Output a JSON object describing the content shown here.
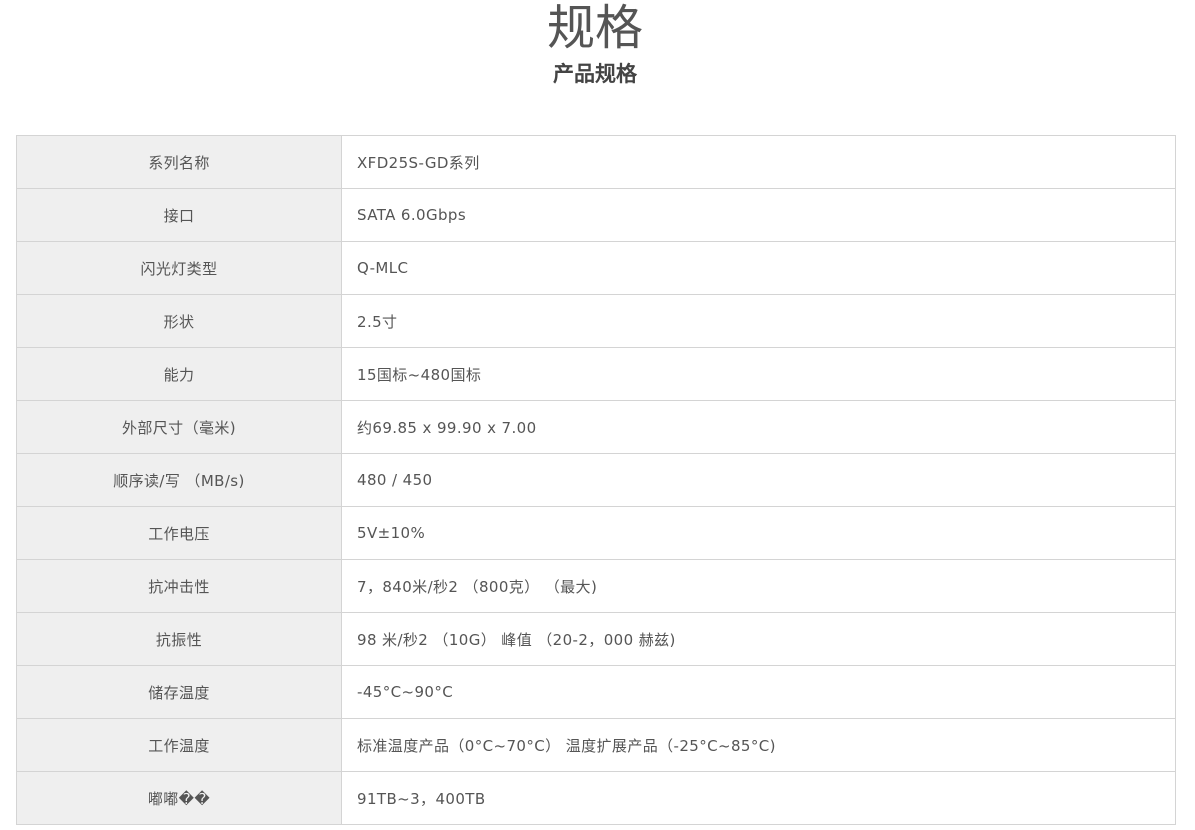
{
  "header": {
    "title": "规格",
    "subtitle": "产品规格"
  },
  "specs": [
    {
      "label": "系列名称",
      "value": "XFD25S-GD系列"
    },
    {
      "label": "接口",
      "value": "SATA 6.0Gbps"
    },
    {
      "label": "闪光灯类型",
      "value": "Q-MLC"
    },
    {
      "label": "形状",
      "value": "2.5寸"
    },
    {
      "label": "能力",
      "value": "15国标~480国标"
    },
    {
      "label": "外部尺寸（毫米)",
      "value": "约69.85 x 99.90 x 7.00"
    },
    {
      "label": "顺序读/写 （MB/s)",
      "value": "480 / 450"
    },
    {
      "label": "工作电压",
      "value": "5V±10%"
    },
    {
      "label": "抗冲击性",
      "value": "7，840米/秒2 （800克） （最大)"
    },
    {
      "label": "抗振性",
      "value": "98 米/秒2 （10G） 峰值 （20-2，000 赫兹)"
    },
    {
      "label": "储存温度",
      "value": "-45°C~90°C"
    },
    {
      "label": "工作温度",
      "value": "标准温度产品（0°C~70°C） 温度扩展产品（-25°C~85°C)"
    },
    {
      "label": "嘟嘟��",
      "value": "91TB~3，400TB"
    }
  ]
}
